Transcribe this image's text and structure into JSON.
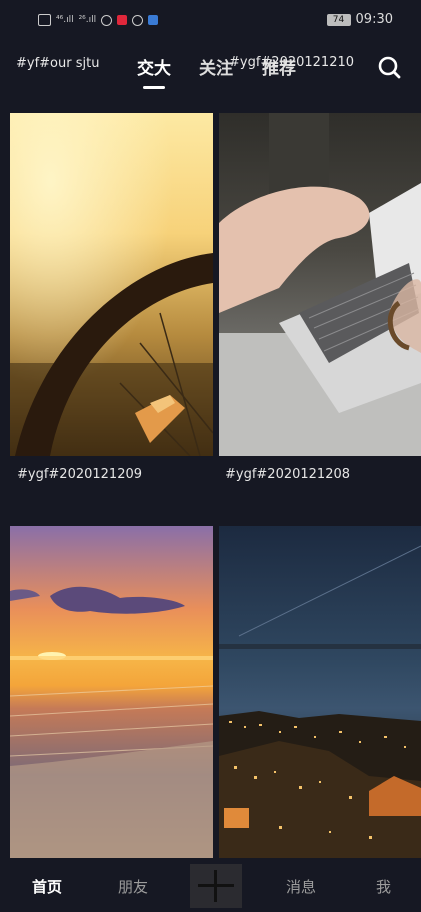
{
  "status_bar": {
    "signal_left": "⁴⁶.ıll",
    "signal_right": "²⁶.ıll",
    "battery": "74",
    "time": "09:30"
  },
  "header": {
    "channel_tag": "#yf#our sjtu",
    "tabs": [
      {
        "label": "交大",
        "active": true
      },
      {
        "label": "关注",
        "active": false
      },
      {
        "label": "推荐",
        "active": false
      }
    ],
    "overlay_tag": "#ygf#2020121210",
    "search_icon": "search-icon"
  },
  "feed": {
    "items": [
      {
        "caption": "#ygf#2020121209",
        "scene": "sunset-bicycle-wheel"
      },
      {
        "caption": "#ygf#2020121208",
        "scene": "hands-typing-laptop"
      },
      {
        "caption": "",
        "scene": "beach-sunset"
      },
      {
        "caption": "",
        "scene": "night-city-coast"
      }
    ]
  },
  "bottom_nav": {
    "items": [
      "首页",
      "朋友",
      "消息",
      "我"
    ],
    "active": "首页",
    "plus_icon": "plus-icon"
  }
}
